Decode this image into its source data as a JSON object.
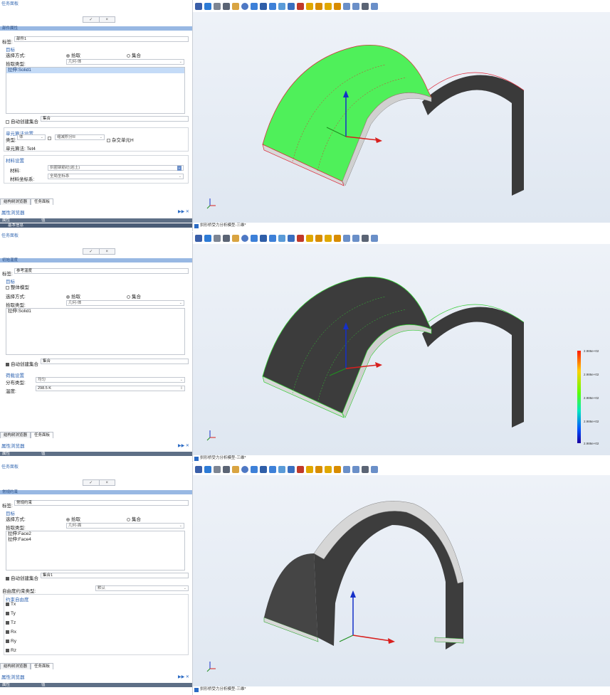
{
  "panel_caption": "任务面板",
  "ok_label": "✓",
  "cancel_label": "×",
  "target_label": "目标",
  "select_mode_label": "选择方式:",
  "pick_label": "拾取",
  "set_label": "集合",
  "pick_type_label": "拾取类型:",
  "auto_create_label": "自动创建集合",
  "title_prefix": "标签:",
  "struct_tree_tab": "结构树浏览器",
  "task_panel_tab": "任务面板",
  "prop_browser": "属性浏览器",
  "prop_col": "属性",
  "val_col": "值",
  "viewport_tab": "拱形桥受力分析模型-三维*",
  "panel1": {
    "header": "部件属性",
    "title_value": "部件1",
    "pick_type_value": "几何-体",
    "list": [
      "拉伸:Solid1"
    ],
    "auto_set_value": "集合",
    "elem_settings_label": "单元算法设置",
    "type_label": "类型:",
    "type_value": "体",
    "mesh_value": "缩减积分R",
    "hybrid_label": "杂交单元H",
    "elem_algo_label": "单元算法: Tet4",
    "material_section": "材料设置",
    "material_label": "材料:",
    "material_value": "拱圈钢筋砼(岩土)",
    "matcoord_label": "材料坐标系:",
    "matcoord_value": "全局坐标系",
    "basic_info": "基本信息"
  },
  "panel2": {
    "header": "初始温度",
    "title_value": "参考温度",
    "whole_model_label": "整体模型",
    "pick_type_value": "几何-体",
    "list": [
      "拉伸:Solid1"
    ],
    "auto_set_value": "集合",
    "load_settings_label": "荷载设置",
    "dist_type_label": "分布类型:",
    "dist_type_value": "均匀",
    "temp_label": "温度:",
    "temp_value": "298.5 K",
    "legend_values": [
      "2.986e+02",
      "2.986e+02",
      "2.986e+02",
      "2.986e+02",
      "2.986e+02"
    ]
  },
  "panel3": {
    "header": "常规约束",
    "title_value": "常规约束",
    "pick_type_value": "几何-面",
    "list": [
      "拉伸:Face2",
      "拉伸:Face4"
    ],
    "auto_set_value": "集合1",
    "dof_type_label": "自由度约束类型:",
    "dof_type_value": "默认",
    "dof_section": "约束自由度",
    "dofs": [
      "Tx",
      "Ty",
      "Tz",
      "Rx",
      "Ry",
      "Rz"
    ]
  }
}
